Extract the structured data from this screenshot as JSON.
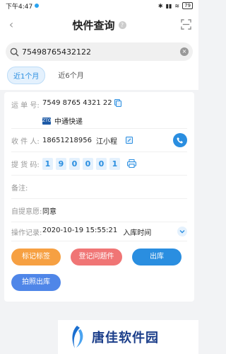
{
  "status": {
    "time": "下午4:47",
    "battery": "79"
  },
  "nav": {
    "title": "快件查询"
  },
  "search": {
    "value": "75498765432122"
  },
  "tabs": [
    {
      "label": "近1个月",
      "active": true
    },
    {
      "label": "近6个月",
      "active": false
    }
  ],
  "detail": {
    "waybill_label": "运 单 号:",
    "waybill_number": "7549  8765  4321  22",
    "courier_logo": "ZTO",
    "courier_name": "中通快递",
    "receiver_label": "收 件 人:",
    "receiver_phone": "18651218956",
    "receiver_name": "江小程",
    "pickup_label": "提 货 码:",
    "pickup_code": [
      "1",
      "9",
      "0",
      "0",
      "0",
      "1"
    ],
    "remark_label": "备注:",
    "self_pick_label": "自提意愿:",
    "self_pick_value": "同意",
    "log_label": "操作记录:",
    "log_time": "2020-10-19 15:55:21",
    "log_action": "入库时间"
  },
  "buttons": {
    "mark_label": "标记标签",
    "issue_label": "登记问题件",
    "outbound_label": "出库",
    "photo_outbound_label": "拍照出库"
  },
  "watermark": {
    "text": "唐佳软件园"
  },
  "colors": {
    "accent": "#2a8ee0",
    "orange": "#f6a042",
    "red": "#f07575"
  }
}
